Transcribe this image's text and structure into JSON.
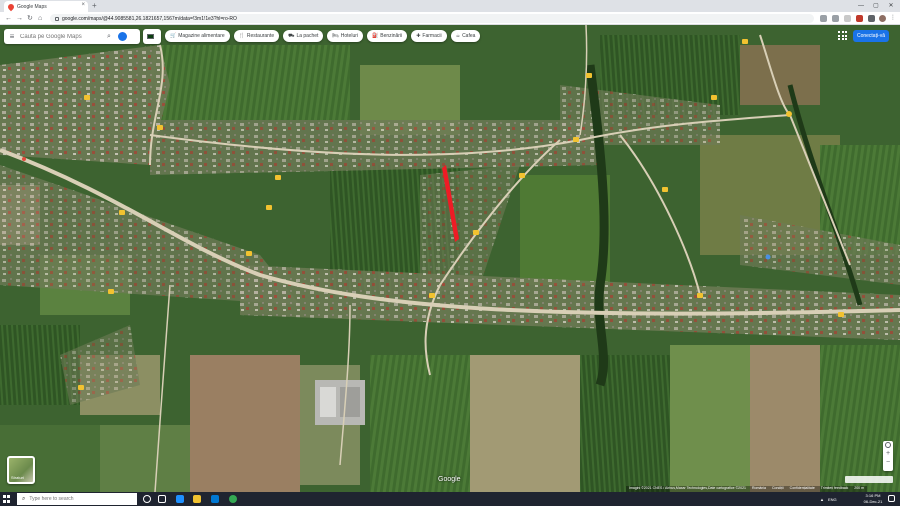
{
  "browser": {
    "tab_title": "Google Maps",
    "tab_close": "×",
    "new_tab": "+",
    "url": "google.com/maps/@44.9085581,26.1821657,1567m/data=!3m1!1e3?hl=ro-RO",
    "back": "←",
    "forward": "→",
    "reload": "↻",
    "home": "⌂",
    "minimize": "—",
    "maximize": "▢",
    "close": "✕"
  },
  "maps": {
    "search_placeholder": "Caută pe Google Maps",
    "menu_icon": "≡",
    "search_icon": "⌕",
    "chips": [
      {
        "icon": "🛒",
        "label": "Magazine alimentare"
      },
      {
        "icon": "🍴",
        "label": "Restaurante"
      },
      {
        "icon": "⛟",
        "label": "La pachet"
      },
      {
        "icon": "🛏",
        "label": "Hoteluri"
      },
      {
        "icon": "⛽",
        "label": "Benzinării"
      },
      {
        "icon": "✚",
        "label": "Farmacii"
      },
      {
        "icon": "☕",
        "label": "Cafea"
      }
    ],
    "signin_label": "Conectați-vă",
    "layer_label": "Straturi",
    "google_logo": "Google",
    "zoom_in": "+",
    "zoom_out": "−",
    "attribution": [
      "Imagini ©2021 CNES / Airbus,Maxar Technologies,Date cartografice ©2021",
      "România",
      "Condiții",
      "Confidențialitate",
      "Trimiteți feedback",
      "200 m"
    ]
  },
  "taskbar": {
    "search_placeholder": "Type here to search",
    "search_icon": "⌕",
    "lang": "ENG",
    "time": "3:16 PM",
    "date": "06-Dec-21"
  },
  "colors": {
    "highlight": "#ee1c25",
    "road": "#d8cfb6",
    "label": "#f2c230"
  }
}
